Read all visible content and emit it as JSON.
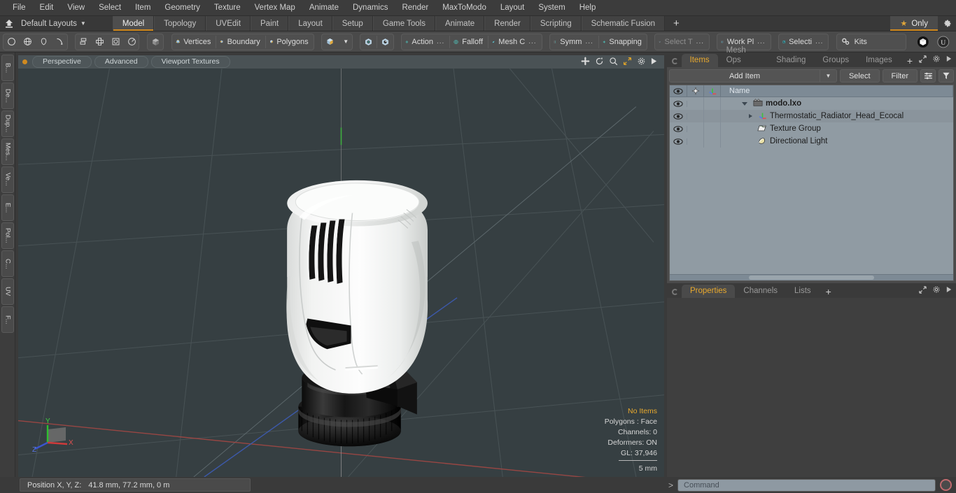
{
  "app": {
    "title": "Modo",
    "menus": [
      "File",
      "Edit",
      "View",
      "Select",
      "Item",
      "Geometry",
      "Texture",
      "Vertex Map",
      "Animate",
      "Dynamics",
      "Render",
      "MaxToModo",
      "Layout",
      "System",
      "Help"
    ]
  },
  "layout_bar": {
    "layouts_label": "Default Layouts",
    "tabs": [
      "Model",
      "Topology",
      "UVEdit",
      "Paint",
      "Layout",
      "Setup",
      "Game Tools",
      "Animate",
      "Render",
      "Scripting",
      "Schematic Fusion"
    ],
    "active_tab": "Model",
    "add_tab_label": "+",
    "only_label": "Only",
    "star_icon": "star-icon",
    "gear_icon": "gear-icon"
  },
  "toolbar": {
    "shape_icons": [
      "circle-tool-icon",
      "globe-tool-icon",
      "pen-tool-icon",
      "curve-tool-icon"
    ],
    "arrange_icons": [
      "align-tool-icon",
      "center-tool-icon",
      "frame-tool-icon",
      "radial-tool-icon"
    ],
    "item_icon": "item-cube-icon",
    "components": [
      {
        "label": "Vertices",
        "icon": "vertices-icon"
      },
      {
        "label": "Boundary",
        "icon": "boundary-icon"
      },
      {
        "label": "Polygons",
        "icon": "polygons-icon"
      }
    ],
    "selection_cube": "selection-cube-icon",
    "dropdown_caret": "chevron-down-icon",
    "falloff_icons": [
      "falloff-sphere-icon",
      "falloff-sphere-alt-icon"
    ],
    "modifiers": [
      {
        "label": "Action",
        "suffix": "...",
        "icon": "action-center-icon"
      },
      {
        "label": "Falloff",
        "suffix": "",
        "icon": "falloff-icon"
      },
      {
        "label": "Mesh C",
        "suffix": "...",
        "icon": "mesh-constraint-icon"
      }
    ],
    "symmetry": {
      "label": "Symm",
      "suffix": "...",
      "icon": "symmetry-icon"
    },
    "snapping": {
      "label": "Snapping",
      "icon": "snapping-icon"
    },
    "select_through": {
      "label": "Select T",
      "suffix": "...",
      "icon": "select-through-icon",
      "disabled": true
    },
    "work_plane": {
      "label": "Work Pl",
      "suffix": "...",
      "icon": "work-plane-icon"
    },
    "selection_set": {
      "label": "Selecti",
      "suffix": "...",
      "icon": "selection-icon"
    },
    "kits": {
      "label": "Kits",
      "icon": "kits-gears-icon"
    },
    "right_icons": [
      "substance-icon",
      "unreal-icon"
    ]
  },
  "left_strip": {
    "tabs": [
      "B...",
      "De...",
      "Dup...",
      "Mes...",
      "Ve...",
      "E...",
      "Pol...",
      "C...",
      "UV",
      "F..."
    ]
  },
  "viewport": {
    "header": {
      "dot": "active-viewport-dot",
      "buttons": [
        "Perspective",
        "Advanced",
        "Viewport Textures"
      ],
      "icons": [
        "pan-icon",
        "rotate-icon",
        "zoom-icon",
        "fit-icon",
        "gear-icon",
        "play-icon"
      ]
    },
    "stats": {
      "selection": "No Items",
      "polygons": "Polygons : Face",
      "channels": "Channels: 0",
      "deformers": "Deformers: ON",
      "gl": "GL: 37,946"
    },
    "scale_label": "5 mm",
    "axis_gizmo": {
      "x": "X",
      "y": "Y",
      "z": "Z"
    },
    "background_color": "#363f42",
    "model_name": "Thermostatic Radiator Head"
  },
  "items_panel": {
    "tabs": [
      "Items",
      "Mesh Ops",
      "Shading",
      "Groups",
      "Images"
    ],
    "active_tab": "Items",
    "add_tab_label": "+",
    "add_item_label": "Add Item",
    "select_label": "Select",
    "filter_label": "Filter",
    "name_column": "Name",
    "column_icons": [
      "eye-icon",
      "lock-icon",
      "axis-icon"
    ],
    "rows": [
      {
        "label": "modo.lxo",
        "icon": "scene-icon",
        "depth": 0,
        "expander": "down",
        "root": true
      },
      {
        "label": "Thermostatic_Radiator_Head_Ecocal",
        "icon": "mesh-icon",
        "depth": 1,
        "expander": "right",
        "root": false
      },
      {
        "label": "Texture Group",
        "icon": "texture-group-icon",
        "depth": 1,
        "expander": "none",
        "root": false
      },
      {
        "label": "Directional Light",
        "icon": "light-icon",
        "depth": 1,
        "expander": "none",
        "root": false
      }
    ],
    "header_icons": [
      "expand-icon",
      "gear-icon",
      "play-icon"
    ]
  },
  "properties_panel": {
    "tabs": [
      "Properties",
      "Channels",
      "Lists"
    ],
    "active_tab": "Properties",
    "add_tab_label": "+",
    "header_icons": [
      "expand-icon",
      "gear-icon",
      "play-icon"
    ]
  },
  "status_bar": {
    "position_label": "Position X, Y, Z:",
    "position_value": "41.8 mm, 77.2 mm, 0 m",
    "command_chevron": ">",
    "command_placeholder": "Command",
    "led_icon": "record-led-icon"
  },
  "colors": {
    "accent": "#d08a20",
    "tab_active_text": "#e8a92e",
    "viewport_bg": "#363f42",
    "tree_bg": "#909ba3"
  }
}
